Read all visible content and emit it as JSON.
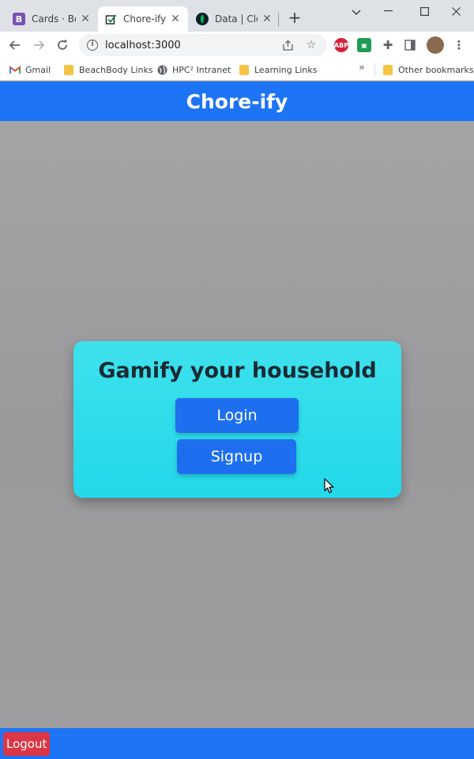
{
  "browser": {
    "tabs": [
      {
        "title": "Cards · Boo",
        "favicon": "bootstrap-icon",
        "active": false
      },
      {
        "title": "Chore-ify",
        "favicon": "checkbox-icon",
        "active": true
      },
      {
        "title": "Data | Clou",
        "favicon": "mongodb-leaf-icon",
        "active": false
      }
    ],
    "url": "localhost:3000",
    "bookmarks": [
      {
        "label": "Gmail",
        "icon": "gmail-icon"
      },
      {
        "label": "BeachBody Links",
        "icon": "folder-icon"
      },
      {
        "label": "HPC² Intranet",
        "icon": "globe-icon"
      },
      {
        "label": "Learning Links",
        "icon": "folder-icon"
      }
    ],
    "other_bookmarks": "Other bookmarks",
    "extensions": [
      "abp-icon",
      "screen-capture-icon",
      "puzzle-icon",
      "side-panel-icon",
      "profile-avatar"
    ]
  },
  "app": {
    "title": "Chore-ify",
    "card": {
      "heading": "Gamify your household",
      "login_label": "Login",
      "signup_label": "Signup"
    },
    "footer": {
      "logout_label": "Logout"
    }
  },
  "colors": {
    "primary": "#1d74f5",
    "card": "#2ad9ea",
    "danger": "#dc3545",
    "background": "#9a9a9c"
  }
}
